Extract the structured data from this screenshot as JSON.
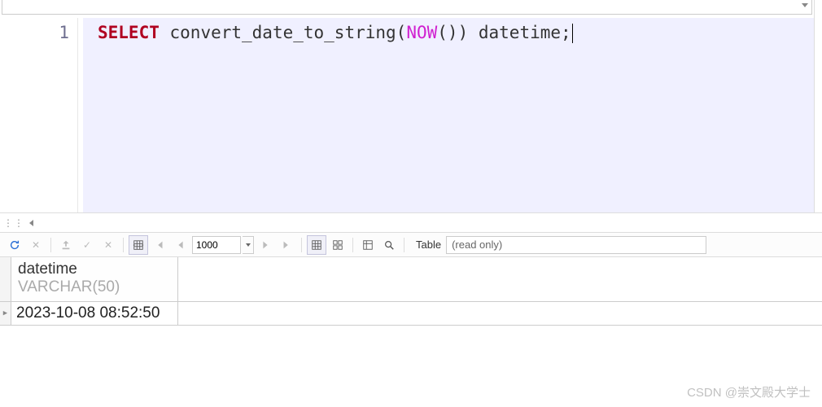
{
  "editor": {
    "line_number": "1",
    "sql": {
      "keyword": "SELECT",
      "func_outer": "convert_date_to_string",
      "func_inner": "NOW",
      "parens_inner": "()",
      "paren_close": ")",
      "alias": "datetime",
      "terminator": ";"
    }
  },
  "toolbar": {
    "limit_value": "1000",
    "mode_label": "Table",
    "mode_value": "(read only)"
  },
  "results": {
    "column_name": "datetime",
    "column_type": "VARCHAR(50)",
    "rows": [
      {
        "value": "2023-10-08 08:52:50"
      }
    ]
  },
  "watermark": "CSDN @崇文殿大学士"
}
